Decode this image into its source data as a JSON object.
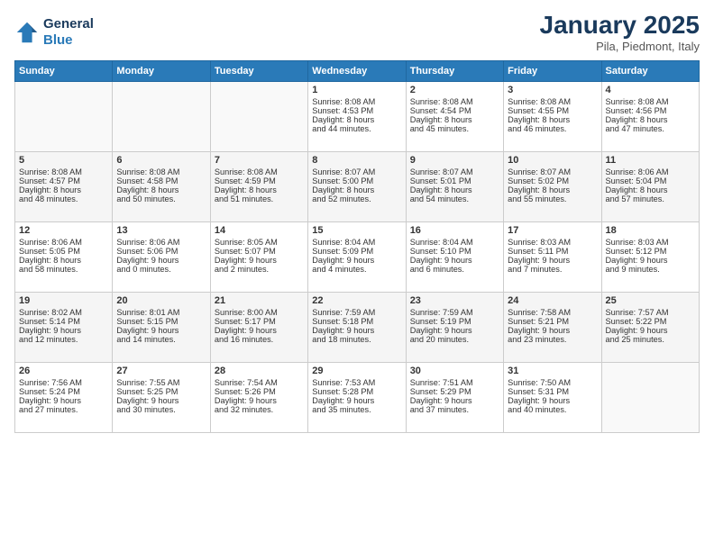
{
  "header": {
    "logo_line1": "General",
    "logo_line2": "Blue",
    "month": "January 2025",
    "location": "Pila, Piedmont, Italy"
  },
  "weekdays": [
    "Sunday",
    "Monday",
    "Tuesday",
    "Wednesday",
    "Thursday",
    "Friday",
    "Saturday"
  ],
  "weeks": [
    [
      {
        "day": "",
        "text": ""
      },
      {
        "day": "",
        "text": ""
      },
      {
        "day": "",
        "text": ""
      },
      {
        "day": "1",
        "text": "Sunrise: 8:08 AM\nSunset: 4:53 PM\nDaylight: 8 hours\nand 44 minutes."
      },
      {
        "day": "2",
        "text": "Sunrise: 8:08 AM\nSunset: 4:54 PM\nDaylight: 8 hours\nand 45 minutes."
      },
      {
        "day": "3",
        "text": "Sunrise: 8:08 AM\nSunset: 4:55 PM\nDaylight: 8 hours\nand 46 minutes."
      },
      {
        "day": "4",
        "text": "Sunrise: 8:08 AM\nSunset: 4:56 PM\nDaylight: 8 hours\nand 47 minutes."
      }
    ],
    [
      {
        "day": "5",
        "text": "Sunrise: 8:08 AM\nSunset: 4:57 PM\nDaylight: 8 hours\nand 48 minutes."
      },
      {
        "day": "6",
        "text": "Sunrise: 8:08 AM\nSunset: 4:58 PM\nDaylight: 8 hours\nand 50 minutes."
      },
      {
        "day": "7",
        "text": "Sunrise: 8:08 AM\nSunset: 4:59 PM\nDaylight: 8 hours\nand 51 minutes."
      },
      {
        "day": "8",
        "text": "Sunrise: 8:07 AM\nSunset: 5:00 PM\nDaylight: 8 hours\nand 52 minutes."
      },
      {
        "day": "9",
        "text": "Sunrise: 8:07 AM\nSunset: 5:01 PM\nDaylight: 8 hours\nand 54 minutes."
      },
      {
        "day": "10",
        "text": "Sunrise: 8:07 AM\nSunset: 5:02 PM\nDaylight: 8 hours\nand 55 minutes."
      },
      {
        "day": "11",
        "text": "Sunrise: 8:06 AM\nSunset: 5:04 PM\nDaylight: 8 hours\nand 57 minutes."
      }
    ],
    [
      {
        "day": "12",
        "text": "Sunrise: 8:06 AM\nSunset: 5:05 PM\nDaylight: 8 hours\nand 58 minutes."
      },
      {
        "day": "13",
        "text": "Sunrise: 8:06 AM\nSunset: 5:06 PM\nDaylight: 9 hours\nand 0 minutes."
      },
      {
        "day": "14",
        "text": "Sunrise: 8:05 AM\nSunset: 5:07 PM\nDaylight: 9 hours\nand 2 minutes."
      },
      {
        "day": "15",
        "text": "Sunrise: 8:04 AM\nSunset: 5:09 PM\nDaylight: 9 hours\nand 4 minutes."
      },
      {
        "day": "16",
        "text": "Sunrise: 8:04 AM\nSunset: 5:10 PM\nDaylight: 9 hours\nand 6 minutes."
      },
      {
        "day": "17",
        "text": "Sunrise: 8:03 AM\nSunset: 5:11 PM\nDaylight: 9 hours\nand 7 minutes."
      },
      {
        "day": "18",
        "text": "Sunrise: 8:03 AM\nSunset: 5:12 PM\nDaylight: 9 hours\nand 9 minutes."
      }
    ],
    [
      {
        "day": "19",
        "text": "Sunrise: 8:02 AM\nSunset: 5:14 PM\nDaylight: 9 hours\nand 12 minutes."
      },
      {
        "day": "20",
        "text": "Sunrise: 8:01 AM\nSunset: 5:15 PM\nDaylight: 9 hours\nand 14 minutes."
      },
      {
        "day": "21",
        "text": "Sunrise: 8:00 AM\nSunset: 5:17 PM\nDaylight: 9 hours\nand 16 minutes."
      },
      {
        "day": "22",
        "text": "Sunrise: 7:59 AM\nSunset: 5:18 PM\nDaylight: 9 hours\nand 18 minutes."
      },
      {
        "day": "23",
        "text": "Sunrise: 7:59 AM\nSunset: 5:19 PM\nDaylight: 9 hours\nand 20 minutes."
      },
      {
        "day": "24",
        "text": "Sunrise: 7:58 AM\nSunset: 5:21 PM\nDaylight: 9 hours\nand 23 minutes."
      },
      {
        "day": "25",
        "text": "Sunrise: 7:57 AM\nSunset: 5:22 PM\nDaylight: 9 hours\nand 25 minutes."
      }
    ],
    [
      {
        "day": "26",
        "text": "Sunrise: 7:56 AM\nSunset: 5:24 PM\nDaylight: 9 hours\nand 27 minutes."
      },
      {
        "day": "27",
        "text": "Sunrise: 7:55 AM\nSunset: 5:25 PM\nDaylight: 9 hours\nand 30 minutes."
      },
      {
        "day": "28",
        "text": "Sunrise: 7:54 AM\nSunset: 5:26 PM\nDaylight: 9 hours\nand 32 minutes."
      },
      {
        "day": "29",
        "text": "Sunrise: 7:53 AM\nSunset: 5:28 PM\nDaylight: 9 hours\nand 35 minutes."
      },
      {
        "day": "30",
        "text": "Sunrise: 7:51 AM\nSunset: 5:29 PM\nDaylight: 9 hours\nand 37 minutes."
      },
      {
        "day": "31",
        "text": "Sunrise: 7:50 AM\nSunset: 5:31 PM\nDaylight: 9 hours\nand 40 minutes."
      },
      {
        "day": "",
        "text": ""
      }
    ]
  ]
}
